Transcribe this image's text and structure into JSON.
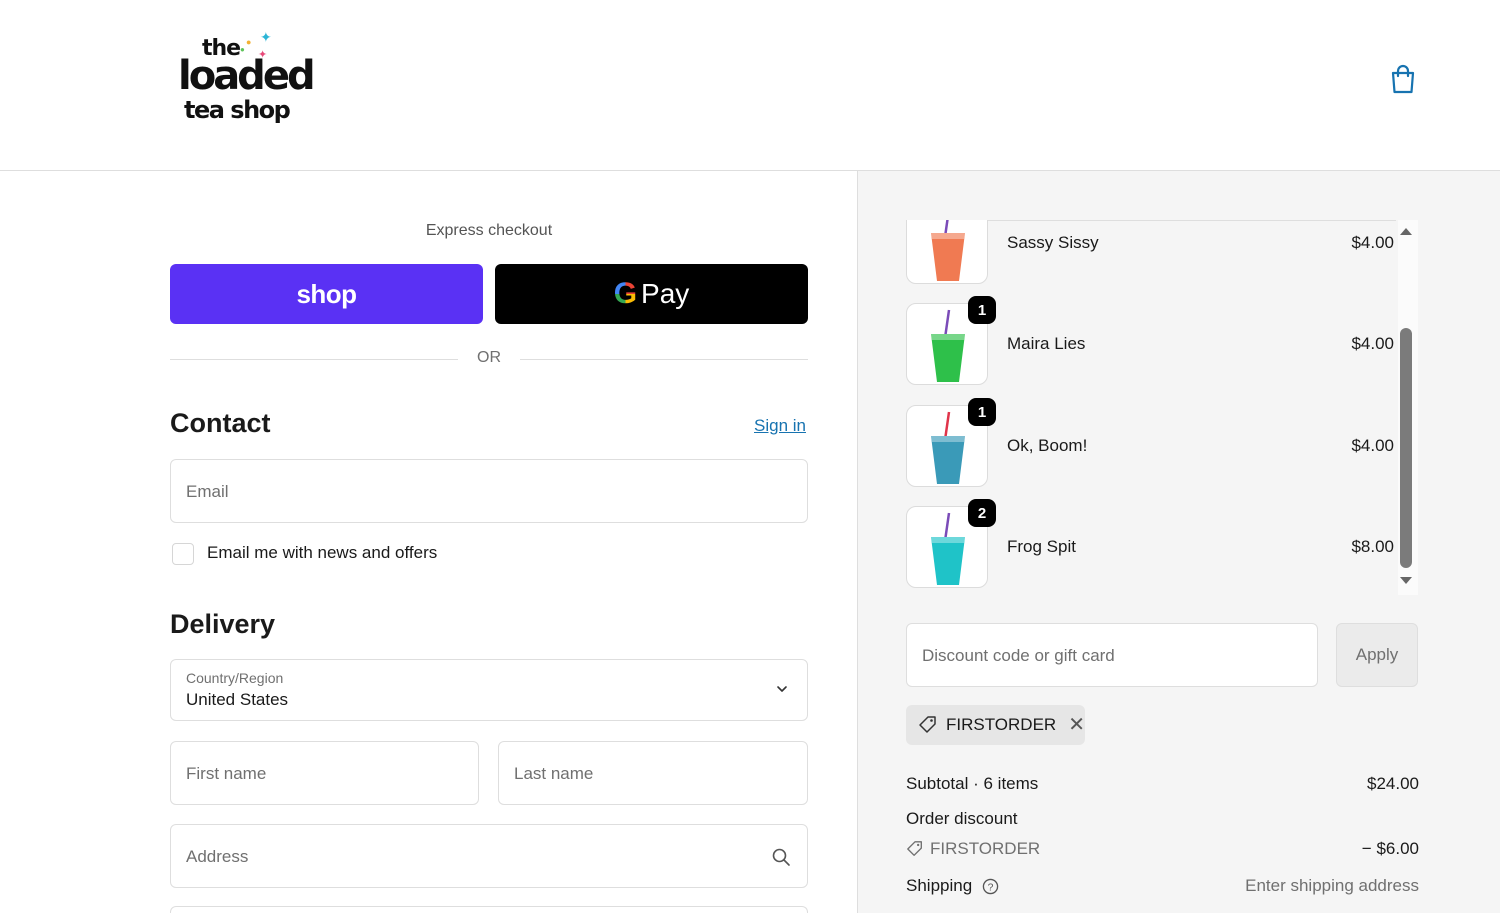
{
  "header": {
    "logo": {
      "line1": "the",
      "line2": "loaded",
      "line3": "tea shop"
    },
    "cart_icon": "shopping-bag-icon",
    "accent_color": "#1773b0"
  },
  "express": {
    "title": "Express checkout",
    "shop_label": "shop",
    "gpay_label": "Pay",
    "gpay_g": "G",
    "or_label": "OR",
    "shop_color": "#5a31f4"
  },
  "contact": {
    "heading": "Contact",
    "signin_label": "Sign in",
    "email_placeholder": "Email",
    "newsletter_label": "Email me with news and offers",
    "newsletter_checked": false
  },
  "delivery": {
    "heading": "Delivery",
    "country_label": "Country/Region",
    "country_value": "United States",
    "first_name_placeholder": "First name",
    "last_name_placeholder": "Last name",
    "address_placeholder": "Address"
  },
  "order": {
    "items": [
      {
        "name": "Sassy Sissy",
        "price": "$4.00",
        "qty": "",
        "drink_color": "#f07a52",
        "straw_color": "#7b4bb8"
      },
      {
        "name": "Maira Lies",
        "price": "$4.00",
        "qty": "1",
        "drink_color": "#2ec04a",
        "straw_color": "#7b4bb8"
      },
      {
        "name": "Ok, Boom!",
        "price": "$4.00",
        "qty": "1",
        "drink_color": "#3a9ab8",
        "straw_color": "#e0344a"
      },
      {
        "name": "Frog Spit",
        "price": "$8.00",
        "qty": "2",
        "drink_color": "#1fc3c8",
        "straw_color": "#7b4bb8"
      }
    ],
    "discount_placeholder": "Discount code or gift card",
    "apply_label": "Apply",
    "applied_code": "FIRSTORDER",
    "summary": {
      "subtotal_label": "Subtotal · 6 items",
      "subtotal_value": "$24.00",
      "discount_label": "Order discount",
      "discount_code": "FIRSTORDER",
      "discount_value": "− $6.00",
      "shipping_label": "Shipping",
      "shipping_value": "Enter shipping address"
    }
  }
}
